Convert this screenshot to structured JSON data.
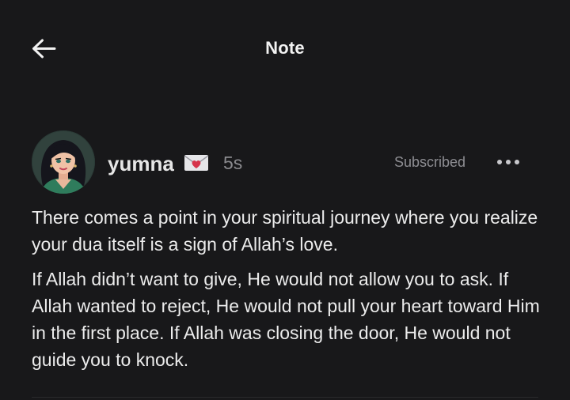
{
  "header": {
    "title": "Note",
    "back_icon": "arrow-left-icon"
  },
  "post": {
    "author": {
      "name": "yumna",
      "badge_icon": "love-letter-icon",
      "avatar_icon": "avatar-illustration"
    },
    "time": "5s",
    "subscription_status": "Subscribed",
    "more_icon": "ellipsis-icon",
    "paragraphs": [
      "There comes a point in your spiritual journey where you realize your dua itself is a sign of Allah’s love.",
      "If Allah didn’t want to give, He would not allow you to ask. If Allah wanted to reject, He would not pull your heart toward Him in the first place. If Allah was closing the door, He would not guide you to knock."
    ]
  },
  "colors": {
    "background": "#18181a",
    "text": "#ececec",
    "muted": "#8e8e93",
    "badge_red": "#d6334a"
  }
}
